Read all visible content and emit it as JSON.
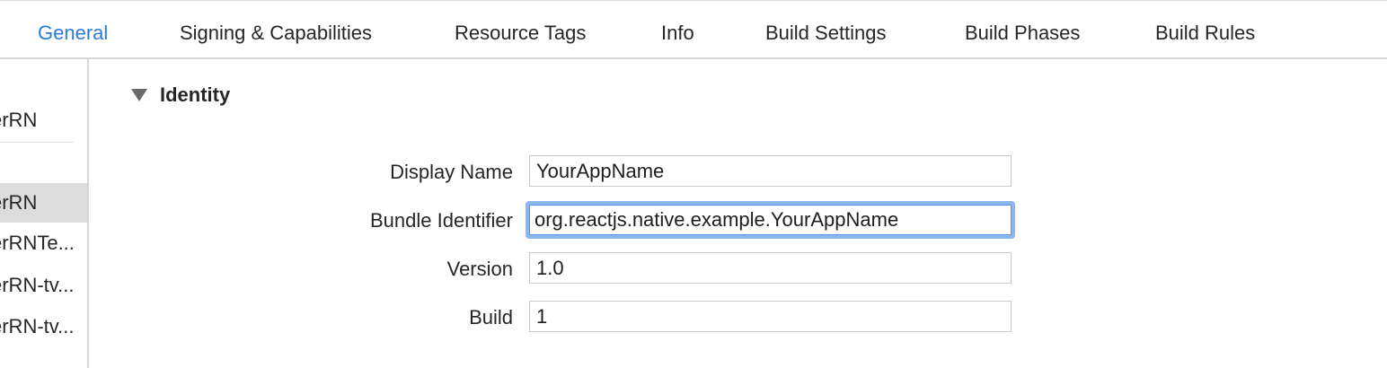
{
  "tabs": [
    {
      "label": "General",
      "active": true
    },
    {
      "label": "Signing & Capabilities"
    },
    {
      "label": "Resource Tags"
    },
    {
      "label": "Info"
    },
    {
      "label": "Build Settings"
    },
    {
      "label": "Build Phases"
    },
    {
      "label": "Build Rules"
    }
  ],
  "sidebar": {
    "project_item": "erRN",
    "targets": [
      {
        "label": "erRN",
        "selected": true
      },
      {
        "label": "erRNTe..."
      },
      {
        "label": "erRN-tv..."
      },
      {
        "label": "erRN-tv..."
      }
    ]
  },
  "identity": {
    "section_title": "Identity",
    "display_name_label": "Display Name",
    "display_name_value": "YourAppName",
    "bundle_identifier_label": "Bundle Identifier",
    "bundle_identifier_value": "org.reactjs.native.example.YourAppName",
    "version_label": "Version",
    "version_value": "1.0",
    "build_label": "Build",
    "build_value": "1"
  },
  "colors": {
    "accent": "#2a7be0",
    "focus_ring": "#8db6ee",
    "selection_bg": "#dcdcdc"
  },
  "icons": {
    "disclosure": "disclosure-triangle-down-icon"
  }
}
